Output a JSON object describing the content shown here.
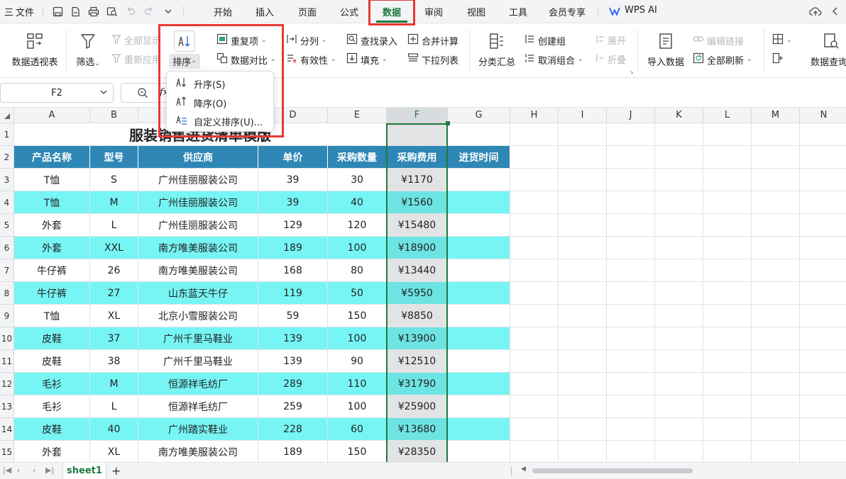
{
  "menubar": {
    "menu_icon": "三",
    "file": "文件",
    "tabs": [
      "开始",
      "插入",
      "页面",
      "公式",
      "数据",
      "审阅",
      "视图",
      "工具",
      "会员专享"
    ],
    "active_tab": "数据",
    "wps_ai": "WPS AI"
  },
  "ribbon": {
    "pivot": "数据透视表",
    "filter": "筛选",
    "show_all": "全部显示",
    "reapply": "重新应用",
    "sort": "排序",
    "duplicates": "重复项",
    "compare": "数据对比",
    "split": "分列",
    "validity": "有效性",
    "lookup": "查找录入",
    "fill": "填充",
    "consolidate": "合并计算",
    "dropdown_list": "下拉列表",
    "subtotal": "分类汇总",
    "create_group": "创建组",
    "ungroup": "取消组合",
    "expand": "展开",
    "collapse": "折叠",
    "import": "导入数据",
    "edit_links": "编辑链接",
    "refresh_all": "全部刷新",
    "query": "数据查询"
  },
  "formula": {
    "cell_ref": "F2",
    "fx": "fx"
  },
  "sort_menu": {
    "asc": "升序(S)",
    "desc": "降序(O)",
    "custom": "自定义排序(U)..."
  },
  "columns": [
    "A",
    "B",
    "C",
    "D",
    "E",
    "F",
    "G",
    "H",
    "I",
    "J",
    "K",
    "L",
    "M",
    "N"
  ],
  "row_numbers": [
    "1",
    "2",
    "3",
    "4",
    "5",
    "6",
    "7",
    "8",
    "9",
    "10",
    "11",
    "12",
    "13",
    "14",
    "15"
  ],
  "sheet": {
    "title": "服装销售进货清单模版",
    "headers": [
      "产品名称",
      "型号",
      "供应商",
      "单价",
      "采购数量",
      "采购费用",
      "进货时间"
    ],
    "rows": [
      [
        "T恤",
        "S",
        "广州佳丽服装公司",
        "39",
        "30",
        "¥1170",
        ""
      ],
      [
        "T恤",
        "M",
        "广州佳丽服装公司",
        "39",
        "40",
        "¥1560",
        ""
      ],
      [
        "外套",
        "L",
        "广州佳丽服装公司",
        "129",
        "120",
        "¥15480",
        ""
      ],
      [
        "外套",
        "XXL",
        "南方唯美服装公司",
        "189",
        "100",
        "¥18900",
        ""
      ],
      [
        "牛仔裤",
        "26",
        "南方唯美服装公司",
        "168",
        "80",
        "¥13440",
        ""
      ],
      [
        "牛仔裤",
        "27",
        "山东蓝天牛仔",
        "119",
        "50",
        "¥5950",
        ""
      ],
      [
        "T恤",
        "XL",
        "北京小雪服装公司",
        "59",
        "150",
        "¥8850",
        ""
      ],
      [
        "皮鞋",
        "37",
        "广州千里马鞋业",
        "139",
        "100",
        "¥13900",
        ""
      ],
      [
        "皮鞋",
        "38",
        "广州千里马鞋业",
        "139",
        "90",
        "¥12510",
        ""
      ],
      [
        "毛衫",
        "M",
        "恒源祥毛纺厂",
        "289",
        "110",
        "¥31790",
        ""
      ],
      [
        "毛衫",
        "L",
        "恒源祥毛纺厂",
        "259",
        "100",
        "¥25900",
        ""
      ],
      [
        "皮鞋",
        "40",
        "广州踏实鞋业",
        "228",
        "60",
        "¥13680",
        ""
      ],
      [
        "外套",
        "XL",
        "南方唯美服装公司",
        "189",
        "150",
        "¥28350",
        ""
      ]
    ]
  },
  "sheetbar": {
    "tab": "sheet1",
    "add": "+"
  },
  "colors": {
    "accent_green": "#1d7a3e",
    "header_blue": "#2e87b4",
    "stripe_cyan": "#77f5f5",
    "highlight_red": "#e53935"
  }
}
